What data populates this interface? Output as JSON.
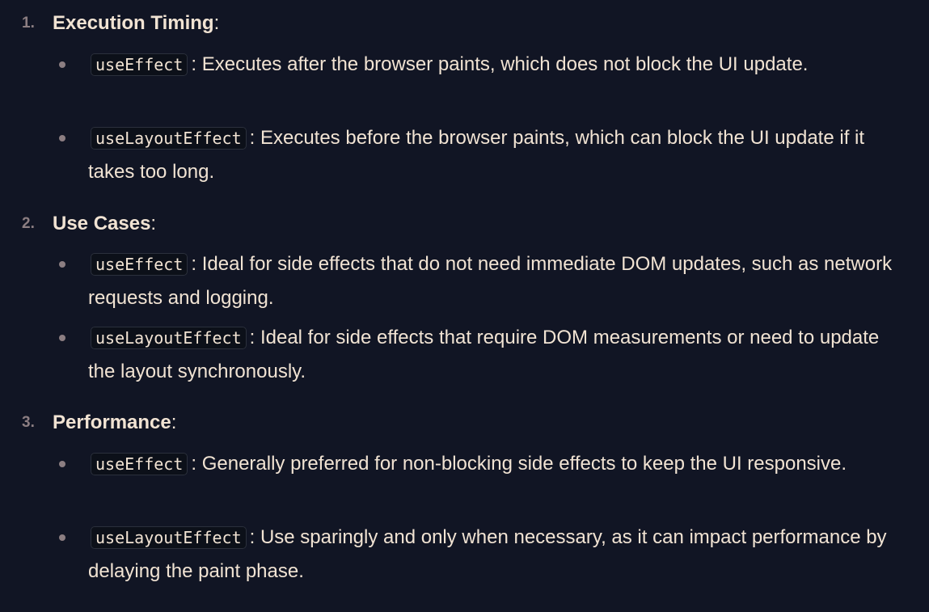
{
  "items": [
    {
      "number": "1.",
      "title": "Execution Timing",
      "colon": ":",
      "bullets": [
        {
          "code": "useEffect",
          "text": ": Executes after the browser paints, which does not block the UI update."
        },
        {
          "code": "useLayoutEffect",
          "text": ": Executes before the browser paints, which can block the UI update if it takes too long."
        }
      ]
    },
    {
      "number": "2.",
      "title": "Use Cases",
      "colon": ":",
      "bullets": [
        {
          "code": "useEffect",
          "text": ": Ideal for side effects that do not need immediate DOM updates, such as network requests and logging."
        },
        {
          "code": "useLayoutEffect",
          "text": ": Ideal for side effects that require DOM measurements or need to update the layout synchronously."
        }
      ]
    },
    {
      "number": "3.",
      "title": "Performance",
      "colon": ":",
      "bullets": [
        {
          "code": "useEffect",
          "text": ": Generally preferred for non-blocking side effects to keep the UI responsive."
        },
        {
          "code": "useLayoutEffect",
          "text": ": Use sparingly and only when necessary, as it can impact performance by delaying the paint phase."
        }
      ]
    }
  ]
}
